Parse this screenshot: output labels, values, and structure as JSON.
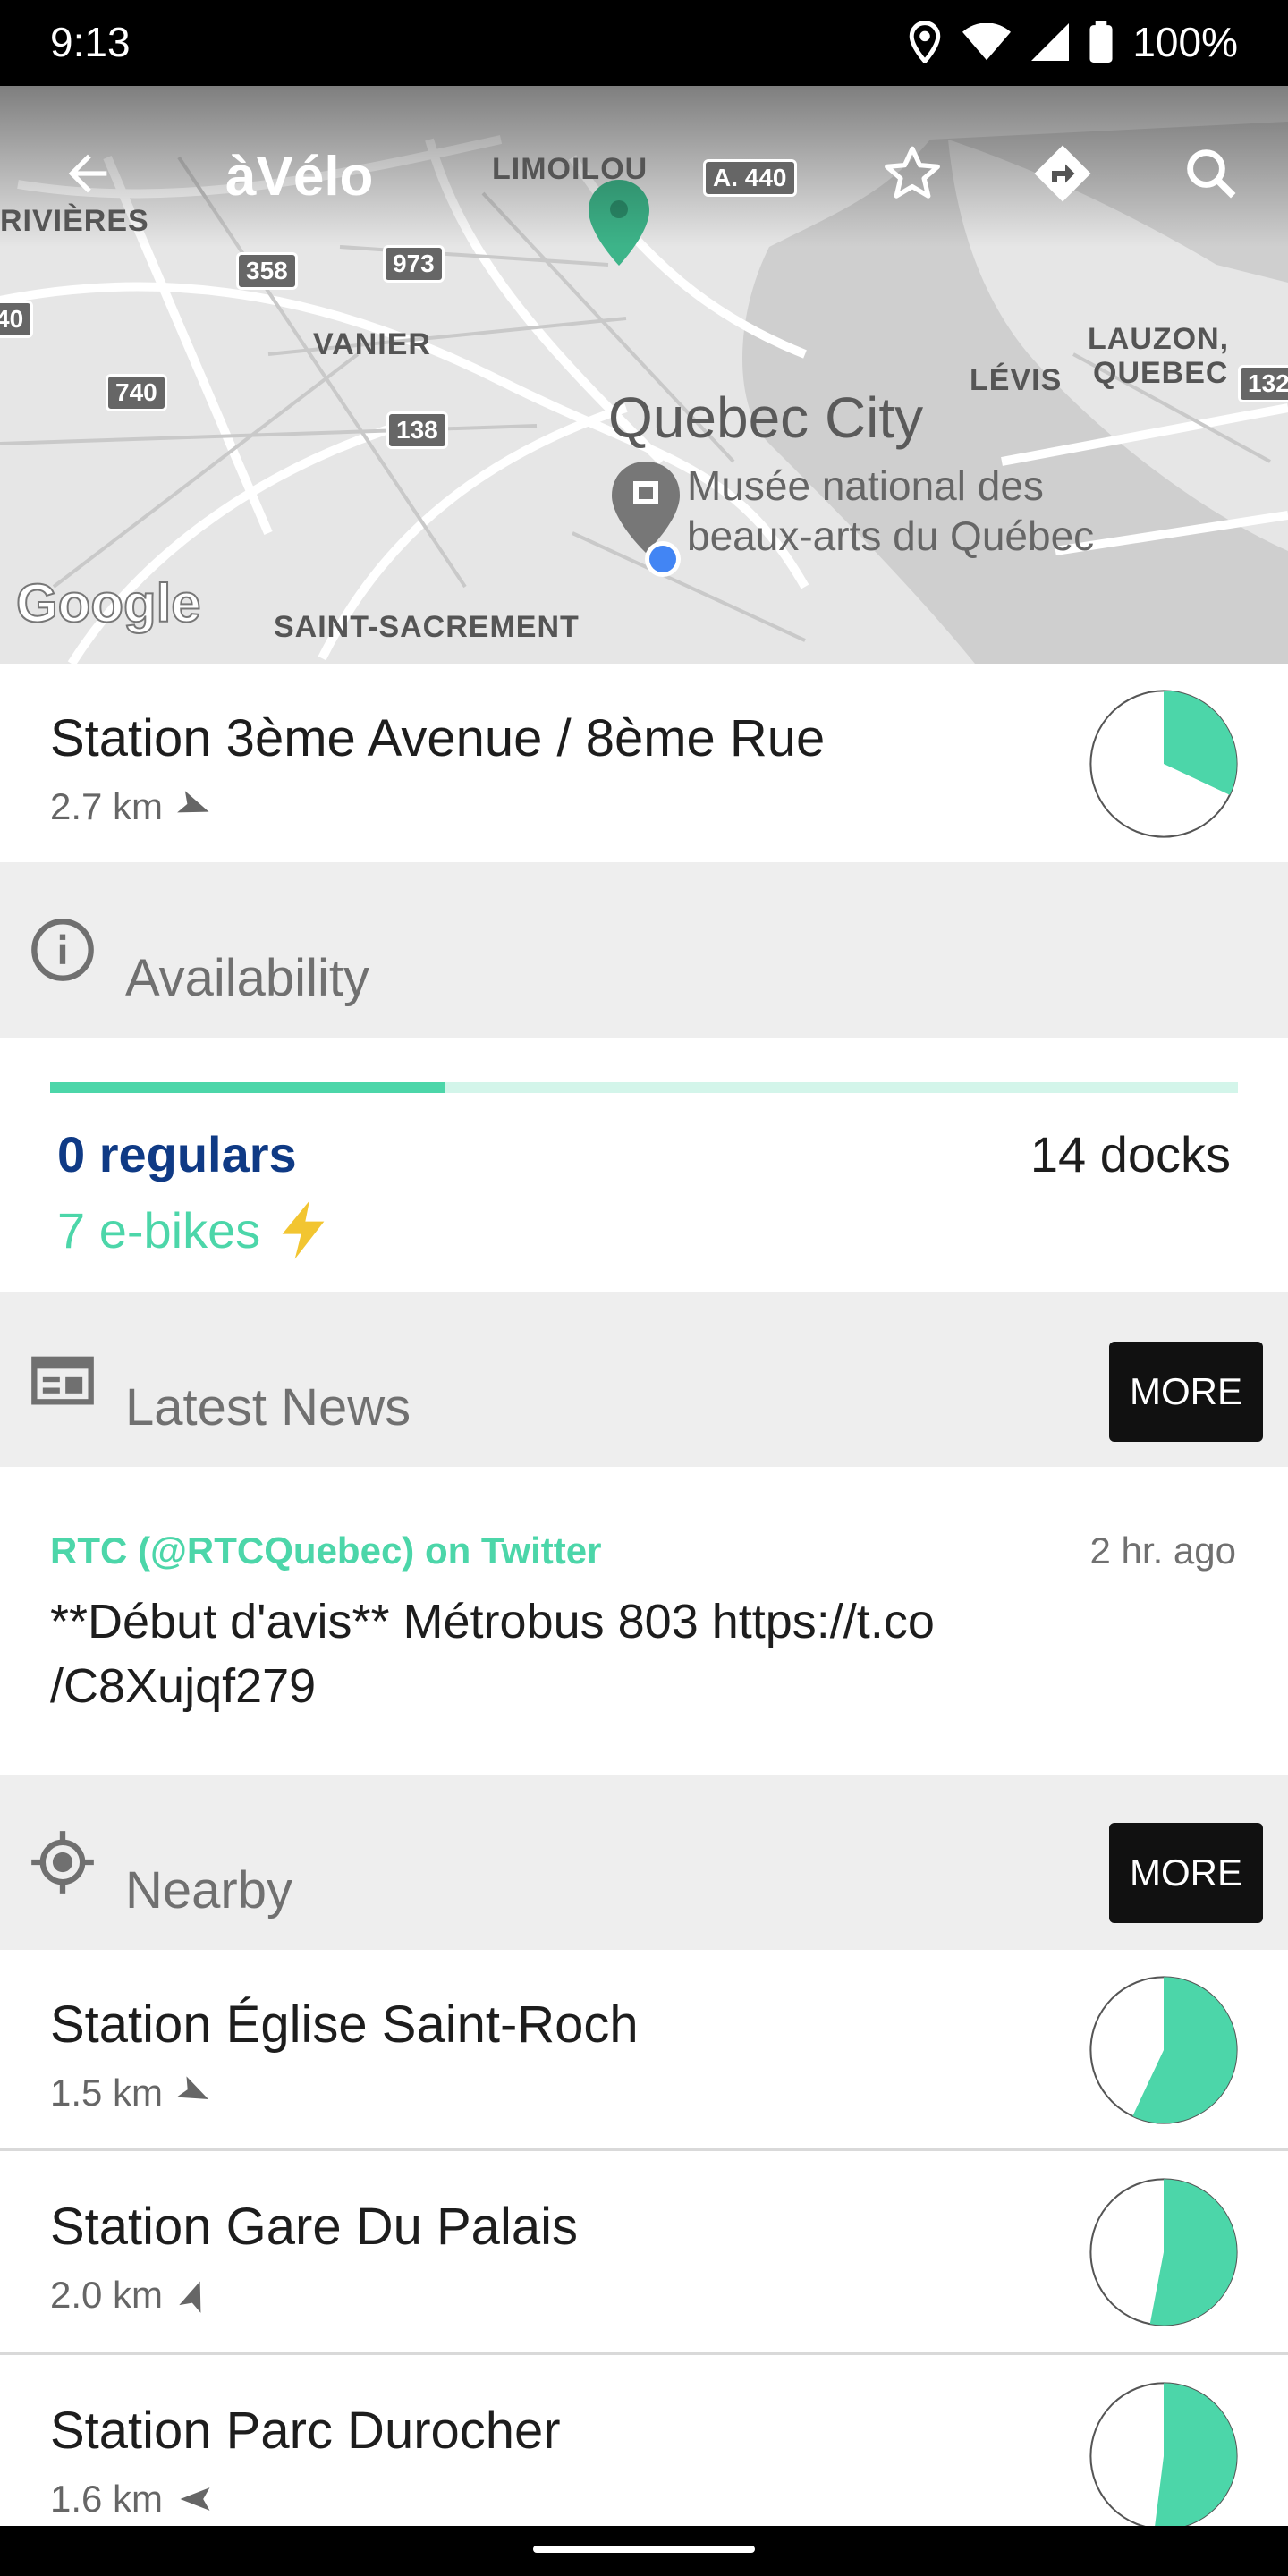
{
  "status_bar": {
    "time": "9:13",
    "battery": "100%"
  },
  "app": {
    "title": "àVélo"
  },
  "map": {
    "labels": [
      "LIMOILOU",
      "RIVIÈRES",
      "VANIER",
      "Quebec City",
      "LÉVIS",
      "LAUZON,",
      "QUEBEC",
      "SAINT-SACREMENT",
      "Google"
    ],
    "shields": [
      "A. 440",
      "358",
      "973",
      "740",
      "138",
      "40",
      "132"
    ],
    "poi": {
      "line1": "Musée national des",
      "line2": "beaux-arts du Québec"
    }
  },
  "station": {
    "name": "Station 3ème Avenue / 8ème Rue",
    "distance": "2.7 km",
    "fill_fraction": 0.32
  },
  "availability": {
    "heading": "Availability",
    "bar_fraction": 0.333,
    "regulars": "0 regulars",
    "ebikes": "7 e-bikes",
    "docks": "14 docks"
  },
  "news": {
    "heading": "Latest News",
    "more": "MORE",
    "source": "RTC (@RTCQuebec) on Twitter",
    "time": "2 hr. ago",
    "text_line1": "**Début d'avis** Métrobus 803 https://t.co",
    "text_line2": "/C8Xujqf279"
  },
  "nearby": {
    "heading": "Nearby",
    "more": "MORE",
    "items": [
      {
        "name": "Station Église Saint-Roch",
        "distance": "1.5 km",
        "fill_fraction": 0.57
      },
      {
        "name": "Station Gare Du Palais",
        "distance": "2.0 km",
        "fill_fraction": 0.53
      },
      {
        "name": "Station Parc Durocher",
        "distance": "1.6 km",
        "fill_fraction": 0.52
      }
    ]
  },
  "colors": {
    "accent": "#4cd6a9",
    "accent_light": "#d3f5ea",
    "regulars_blue": "#0f3a85",
    "ebike_bolt": "#f2c531",
    "map_pin": "#3db489",
    "location_dot": "#4285f4"
  }
}
